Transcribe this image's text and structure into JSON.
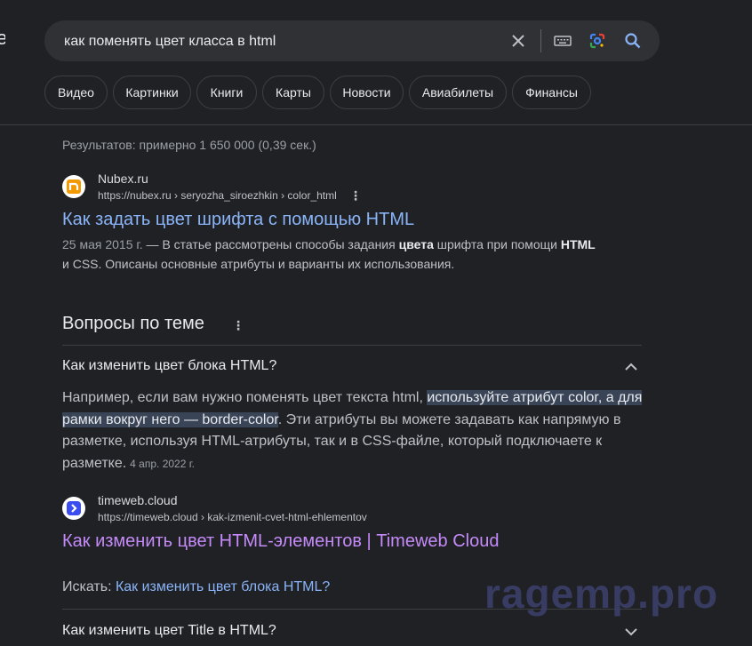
{
  "logo_fragment": "e",
  "search": {
    "query": "как поменять цвет класса в html",
    "clear_icon": "close-icon",
    "keyboard_icon": "keyboard-icon",
    "lens_icon": "google-lens-icon",
    "search_icon": "search-icon"
  },
  "chips": [
    "Видео",
    "Картинки",
    "Книги",
    "Карты",
    "Новости",
    "Авиабилеты",
    "Финансы"
  ],
  "stats": "Результатов: примерно 1 650 000 (0,39 сек.)",
  "result1": {
    "site_name": "Nubex.ru",
    "url": "https://nubex.ru › seryozha_siroezhkin › color_html",
    "title": "Как задать цвет шрифта с помощью HTML",
    "date": "25 мая 2015 г.",
    "snippet_a": " — В статье рассмотрены способы задания ",
    "snippet_b1": "цвета",
    "snippet_c": " шрифта при помощи ",
    "snippet_b2": "HTML",
    "snippet_d": "и CSS. Описаны основные атрибуты и варианты их использования."
  },
  "paa": {
    "heading": "Вопросы по теме",
    "q1": "Как изменить цвет блока HTML?",
    "answer_plain": "Например, если вам нужно поменять цвет текста html, ",
    "answer_highlight": "используйте атрибут color, а для рамки вокруг него — border-color",
    "answer_rest": ". Эти атрибуты вы можете задавать как напрямую в разметке, используя HTML-атрибуты, так и в CSS-файле, который подключаете к разметке.",
    "answer_date": "4 апр. 2022 г.",
    "source": {
      "site_name": "timeweb.cloud",
      "url": "https://timeweb.cloud › kak-izmenit-cvet-html-ehlementov",
      "title": "Как изменить цвет HTML-элементов | Timeweb Cloud"
    },
    "search_for_label": "Искать: ",
    "search_for_link": "Как изменить цвет блока HTML?",
    "q2": "Как изменить цвет Title в HTML?"
  },
  "watermark": "ragemp.pro",
  "colors": {
    "background": "#202124",
    "link": "#8ab4f8",
    "visited_link": "#c58af9",
    "highlight": "#394457"
  }
}
